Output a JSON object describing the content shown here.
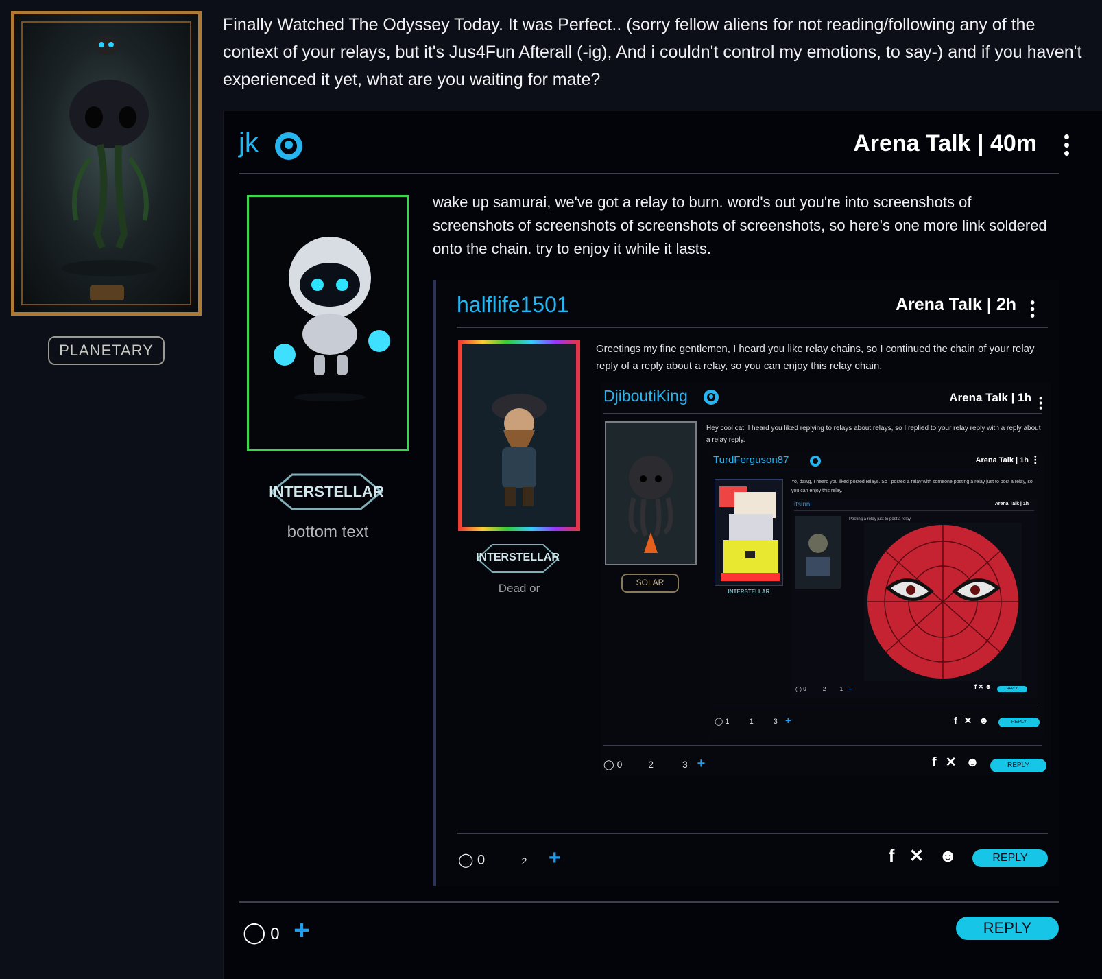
{
  "outer": {
    "badge": "PLANETARY",
    "post_text": "Finally Watched The Odyssey Today. It was Perfect.. (sorry fellow aliens for not reading/following any of the context of your relays, but it's Jus4Fun Afterall (-ig), And i couldn't control my emotions, to say-) and if you haven't experienced it yet, what are you waiting for mate?"
  },
  "relay1": {
    "username": "jk",
    "arena": "Arena Talk",
    "time": "40m",
    "text": "wake up samurai, we've got a relay to burn. word's out you're into screenshots of screenshots of screenshots of screenshots of screenshots, so here's one more link soldered onto the chain. try to enjoy it while it lasts.",
    "badge": "INTERSTELLAR",
    "caption": "bottom text",
    "comments": "0",
    "reply": "REPLY"
  },
  "relay2": {
    "username": "halflife1501",
    "arena": "Arena Talk",
    "time": "2h",
    "text": "Greetings my fine gentlemen, I heard you like relay chains, so I continued the chain of your relay reply of a reply about a relay, so you can enjoy this relay chain.",
    "badge": "INTERSTELLAR",
    "caption": "Dead or",
    "comments": "0",
    "reaction_count": "2",
    "reply": "REPLY"
  },
  "relay3": {
    "username": "DjiboutiKing",
    "arena": "Arena Talk",
    "time": "1h",
    "text": "Hey cool cat, I heard you liked replying to relays about relays, so I replied to your relay reply with a reply about a relay reply.",
    "badge": "SOLAR",
    "comments": "0",
    "reaction_a": "2",
    "reaction_b": "3",
    "reply": "REPLY"
  },
  "relay4": {
    "username": "TurdFerguson87",
    "arena": "Arena Talk",
    "time": "1h",
    "text": "Yo, dawg, I heard you liked posted relays. So I posted a relay with someone posting a relay just to post a relay, so you can enjoy this relay.",
    "badge": "INTERSTELLAR",
    "comments": "1",
    "reaction_a": "1",
    "reaction_b": "3",
    "reply": "REPLY"
  },
  "relay5": {
    "username": "itsinni",
    "arena": "Arena Talk",
    "time": "1h",
    "text": "Posting a relay just to post a relay",
    "comments": "0",
    "reaction_a": "2",
    "reaction_b": "1",
    "reply": "REPLY"
  },
  "colors": {
    "accent": "#17c6e6",
    "username": "#27b5f0",
    "green_frame": "#38d84a",
    "gold_frame": "#b07a33"
  }
}
